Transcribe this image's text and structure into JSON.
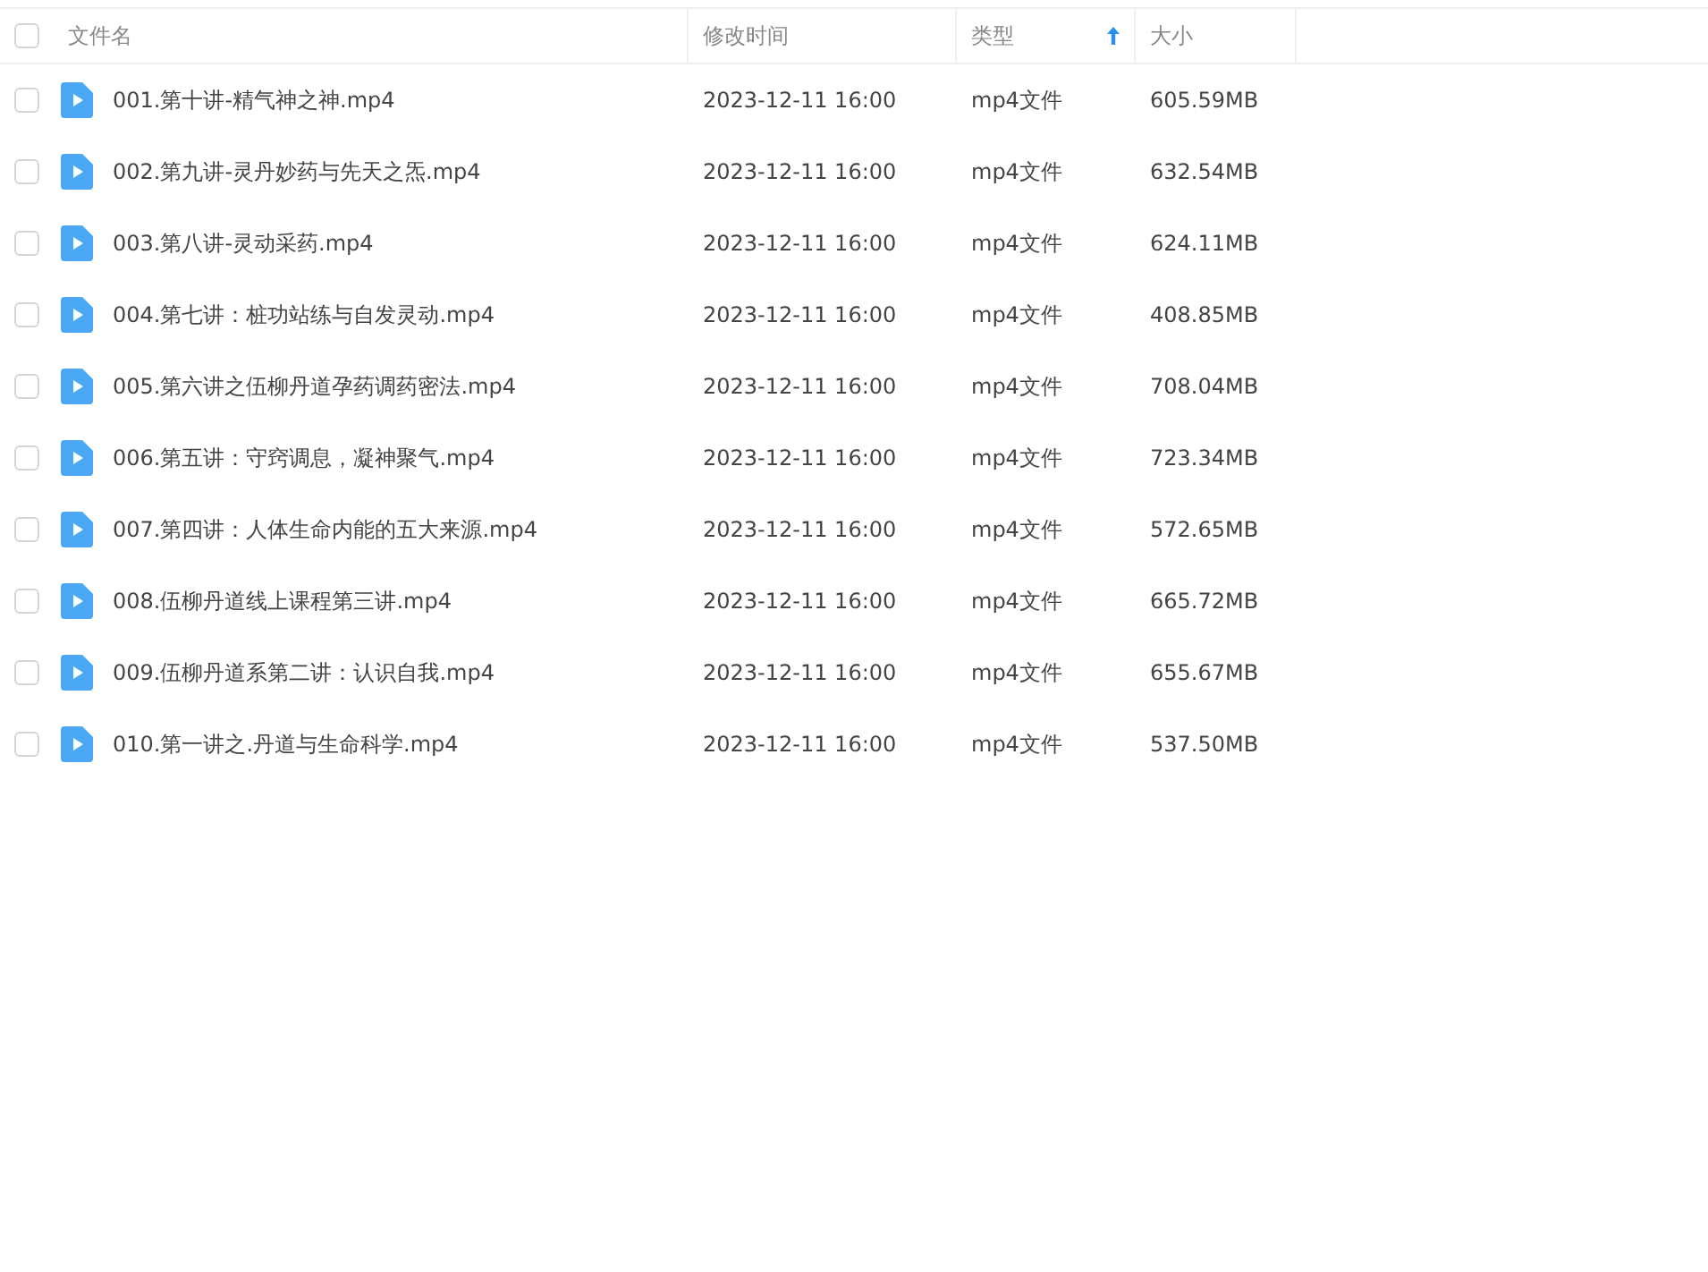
{
  "header": {
    "select_all": {
      "checked": false
    },
    "columns": [
      {
        "label": "文件名",
        "sorted": false
      },
      {
        "label": "修改时间",
        "sorted": false
      },
      {
        "label": "类型",
        "sorted": true
      },
      {
        "label": "大小",
        "sorted": false
      }
    ]
  },
  "rows": [
    {
      "name": "001.第十讲-精气神之神.mp4",
      "modified": "2023-12-11 16:00",
      "type": "mp4文件",
      "size": "605.59MB",
      "checked": false
    },
    {
      "name": "002.第九讲-灵丹妙药与先天之炁.mp4",
      "modified": "2023-12-11 16:00",
      "type": "mp4文件",
      "size": "632.54MB",
      "checked": false
    },
    {
      "name": "003.第八讲-灵动采药.mp4",
      "modified": "2023-12-11 16:00",
      "type": "mp4文件",
      "size": "624.11MB",
      "checked": false
    },
    {
      "name": "004.第七讲：桩功站练与自发灵动.mp4",
      "modified": "2023-12-11 16:00",
      "type": "mp4文件",
      "size": "408.85MB",
      "checked": false
    },
    {
      "name": "005.第六讲之伍柳丹道孕药调药密法.mp4",
      "modified": "2023-12-11 16:00",
      "type": "mp4文件",
      "size": "708.04MB",
      "checked": false
    },
    {
      "name": "006.第五讲：守窍调息，凝神聚气.mp4",
      "modified": "2023-12-11 16:00",
      "type": "mp4文件",
      "size": "723.34MB",
      "checked": false
    },
    {
      "name": "007.第四讲：人体生命内能的五大来源.mp4",
      "modified": "2023-12-11 16:00",
      "type": "mp4文件",
      "size": "572.65MB",
      "checked": false
    },
    {
      "name": "008.伍柳丹道线上课程第三讲.mp4",
      "modified": "2023-12-11 16:00",
      "type": "mp4文件",
      "size": "665.72MB",
      "checked": false
    },
    {
      "name": "009.伍柳丹道系第二讲：认识自我.mp4",
      "modified": "2023-12-11 16:00",
      "type": "mp4文件",
      "size": "655.67MB",
      "checked": false
    },
    {
      "name": "010.第一讲之.丹道与生命科学.mp4",
      "modified": "2023-12-11 16:00",
      "type": "mp4文件",
      "size": "537.50MB",
      "checked": false
    }
  ]
}
